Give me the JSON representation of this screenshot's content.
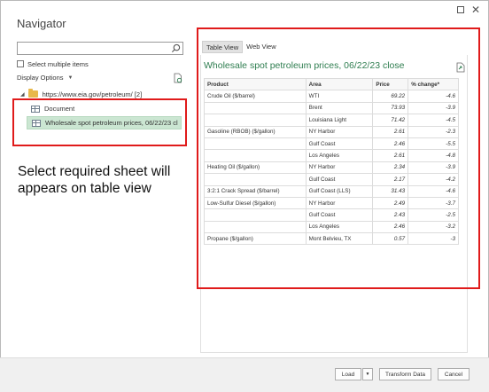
{
  "navigator": {
    "title": "Navigator",
    "search_placeholder": "",
    "select_multiple_label": "Select multiple items",
    "display_options_label": "Display Options",
    "tree": {
      "root_label": "https://www.eia.gov/petroleum/ [2]",
      "items": [
        {
          "label": "Document"
        },
        {
          "label": "Wholesale spot petroleum prices, 06/22/23 cl..."
        }
      ]
    }
  },
  "annotation": {
    "text": "Select required sheet will appears on table view"
  },
  "preview": {
    "tabs": [
      {
        "label": "Table View"
      },
      {
        "label": "Web View"
      }
    ],
    "title": "Wholesale spot petroleum prices, 06/22/23 close",
    "columns": [
      "Product",
      "Area",
      "Price",
      "% change*"
    ],
    "rows": [
      [
        "Crude Oil ($/barrel)",
        "WTI",
        "69.22",
        "-4.6"
      ],
      [
        "",
        "Brent",
        "73.93",
        "-3.9"
      ],
      [
        "",
        "Louisiana Light",
        "71.42",
        "-4.5"
      ],
      [
        "Gasoline (RBOB) ($/gallon)",
        "NY Harbor",
        "2.61",
        "-2.3"
      ],
      [
        "",
        "Gulf Coast",
        "2.46",
        "-5.5"
      ],
      [
        "",
        "Los Angeles",
        "2.61",
        "-4.8"
      ],
      [
        "Heating Oil ($/gallon)",
        "NY Harbor",
        "2.34",
        "-3.9"
      ],
      [
        "",
        "Gulf Coast",
        "2.17",
        "-4.2"
      ],
      [
        "3:2:1 Crack Spread ($/barrel)",
        "Gulf Coast (LLS)",
        "31.43",
        "-4.6"
      ],
      [
        "Low-Sulfur Diesel ($/gallon)",
        "NY Harbor",
        "2.49",
        "-3.7"
      ],
      [
        "",
        "Gulf Coast",
        "2.43",
        "-2.5"
      ],
      [
        "",
        "Los Angeles",
        "2.46",
        "-3.2"
      ],
      [
        "Propane ($/gallon)",
        "Mont Belvieu, TX",
        "0.57",
        "-3"
      ]
    ]
  },
  "buttons": {
    "load": "Load",
    "transform": "Transform Data",
    "cancel": "Cancel"
  },
  "colors": {
    "accent_green": "#2e7d4f",
    "selection_bg": "#cbe6d2",
    "highlight_red": "#e01b1b"
  }
}
